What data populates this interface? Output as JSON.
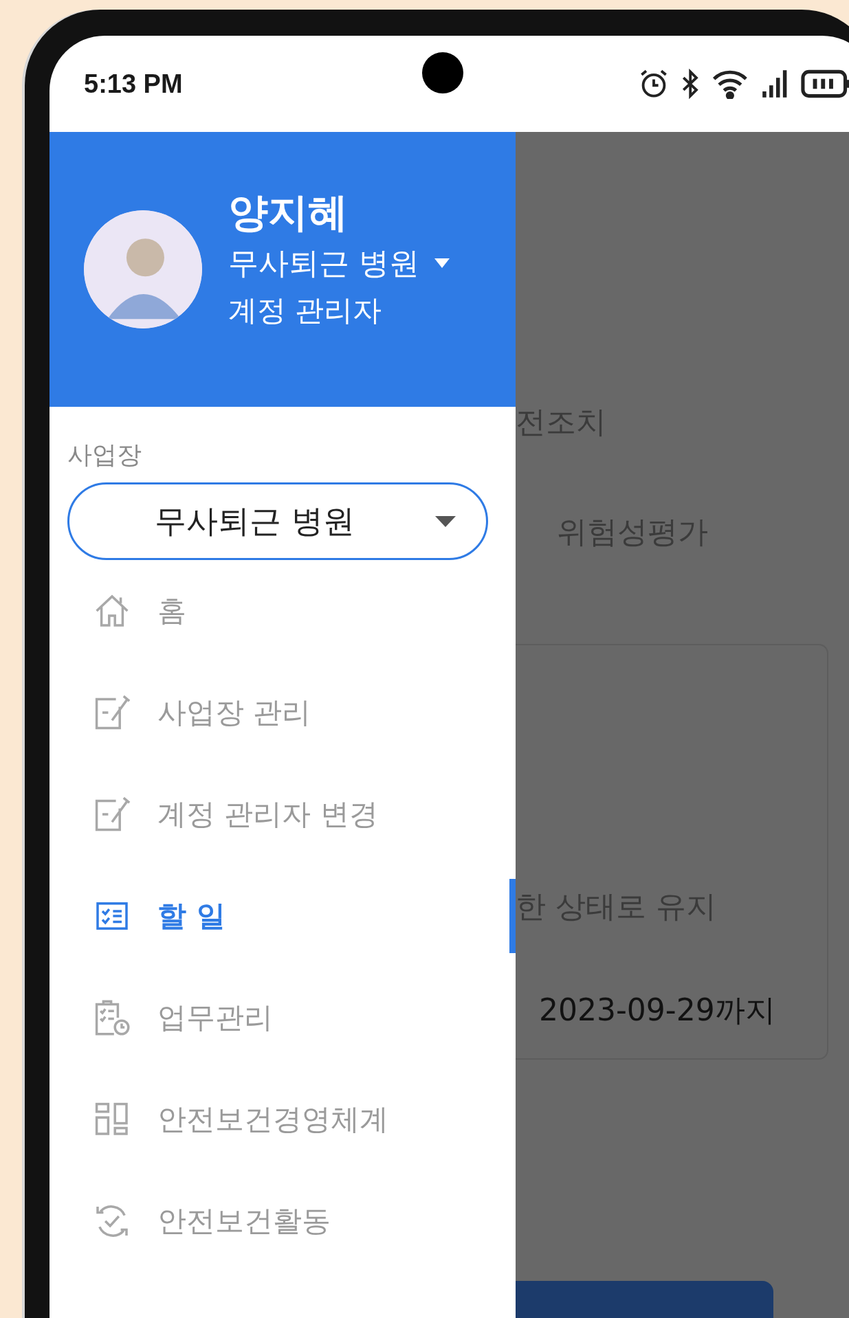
{
  "status_bar": {
    "time": "5:13 PM"
  },
  "drawer": {
    "header": {
      "name": "양지혜",
      "workplace": "무사퇴근 병원",
      "role": "계정 관리자"
    },
    "workplace_select": {
      "label": "사업장",
      "value": "무사퇴근 병원"
    },
    "menu": [
      {
        "label": "홈",
        "kind": "home",
        "selected": false
      },
      {
        "label": "사업장 관리",
        "kind": "edit",
        "selected": false
      },
      {
        "label": "계정 관리자 변경",
        "kind": "edit",
        "selected": false
      },
      {
        "label": "할 일",
        "kind": "checklist",
        "selected": true
      },
      {
        "label": "업무관리",
        "kind": "clipboard",
        "selected": false
      },
      {
        "label": "안전보건경영체계",
        "kind": "grid",
        "selected": false
      },
      {
        "label": "안전보건활동",
        "kind": "refresh",
        "selected": false
      }
    ]
  },
  "background": {
    "section_label": "전조치",
    "tab": "위험성평가",
    "card": {
      "description": "한 상태로 유지",
      "due": "2023-09-29까지"
    }
  }
}
